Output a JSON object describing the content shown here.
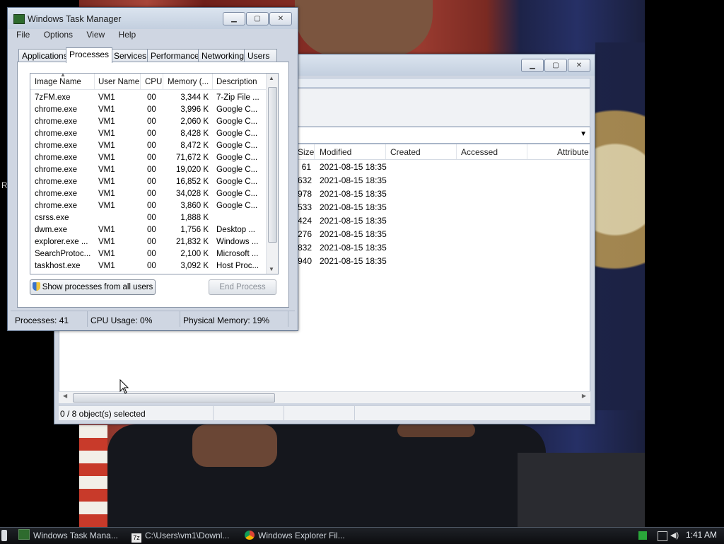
{
  "desktop": {
    "edge_char": "R"
  },
  "explorer": {
    "columns": [
      "Size",
      "Modified",
      "Created",
      "Accessed",
      "Attribute"
    ],
    "rows": [
      {
        "size": "61",
        "modified": "2021-08-15 18:35"
      },
      {
        "size": "632",
        "modified": "2021-08-15 18:35"
      },
      {
        "size": "978",
        "modified": "2021-08-15 18:35"
      },
      {
        "size": "533",
        "modified": "2021-08-15 18:35"
      },
      {
        "size": "424",
        "modified": "2021-08-15 18:35"
      },
      {
        "size": "276",
        "modified": "2021-08-15 18:35"
      },
      {
        "size": "832",
        "modified": "2021-08-15 18:35"
      },
      {
        "size": "940",
        "modified": "2021-08-15 18:35"
      }
    ],
    "status": "0 / 8 object(s) selected",
    "controls": {
      "minimize": "▁",
      "maximize": "▢",
      "close": "✕"
    }
  },
  "taskmgr": {
    "title": "Windows Task Manager",
    "menu": [
      "File",
      "Options",
      "View",
      "Help"
    ],
    "tabs": [
      "Applications",
      "Processes",
      "Services",
      "Performance",
      "Networking",
      "Users"
    ],
    "active_tab": "Processes",
    "columns": [
      "Image Name",
      "User Name",
      "CPU",
      "Memory (...",
      "Description"
    ],
    "processes": [
      {
        "name": "7zFM.exe",
        "user": "VM1",
        "cpu": "00",
        "mem": "3,344 K",
        "desc": "7-Zip File ..."
      },
      {
        "name": "chrome.exe",
        "user": "VM1",
        "cpu": "00",
        "mem": "3,996 K",
        "desc": "Google C..."
      },
      {
        "name": "chrome.exe",
        "user": "VM1",
        "cpu": "00",
        "mem": "2,060 K",
        "desc": "Google C..."
      },
      {
        "name": "chrome.exe",
        "user": "VM1",
        "cpu": "00",
        "mem": "8,428 K",
        "desc": "Google C..."
      },
      {
        "name": "chrome.exe",
        "user": "VM1",
        "cpu": "00",
        "mem": "8,472 K",
        "desc": "Google C..."
      },
      {
        "name": "chrome.exe",
        "user": "VM1",
        "cpu": "00",
        "mem": "71,672 K",
        "desc": "Google C..."
      },
      {
        "name": "chrome.exe",
        "user": "VM1",
        "cpu": "00",
        "mem": "19,020 K",
        "desc": "Google C..."
      },
      {
        "name": "chrome.exe",
        "user": "VM1",
        "cpu": "00",
        "mem": "16,852 K",
        "desc": "Google C..."
      },
      {
        "name": "chrome.exe",
        "user": "VM1",
        "cpu": "00",
        "mem": "34,028 K",
        "desc": "Google C..."
      },
      {
        "name": "chrome.exe",
        "user": "VM1",
        "cpu": "00",
        "mem": "3,860 K",
        "desc": "Google C..."
      },
      {
        "name": "csrss.exe",
        "user": "",
        "cpu": "00",
        "mem": "1,888 K",
        "desc": ""
      },
      {
        "name": "dwm.exe",
        "user": "VM1",
        "cpu": "00",
        "mem": "1,756 K",
        "desc": "Desktop ..."
      },
      {
        "name": "explorer.exe ...",
        "user": "VM1",
        "cpu": "00",
        "mem": "21,832 K",
        "desc": "Windows ..."
      },
      {
        "name": "SearchProtoc...",
        "user": "VM1",
        "cpu": "00",
        "mem": "2,100 K",
        "desc": "Microsoft ..."
      },
      {
        "name": "taskhost.exe",
        "user": "VM1",
        "cpu": "00",
        "mem": "3,092 K",
        "desc": "Host Proc..."
      }
    ],
    "show_all_button": "Show processes from all users",
    "end_process_button": "End Process",
    "status": {
      "processes": "Processes: 41",
      "cpu": "CPU Usage: 0%",
      "memory": "Physical Memory: 19%"
    },
    "controls": {
      "minimize": "▁",
      "maximize": "▢",
      "close": "✕"
    }
  },
  "taskbar": {
    "items": [
      {
        "label": "Windows Task Mana..."
      },
      {
        "label": "C:\\Users\\vm1\\Downl..."
      },
      {
        "label": "Windows Explorer Fil..."
      }
    ],
    "clock": "1:41 AM"
  },
  "colors": {
    "window_frame": "#cfd6e2",
    "taskbar": "#0c0d10",
    "selection_accent": "#3b73c9"
  }
}
